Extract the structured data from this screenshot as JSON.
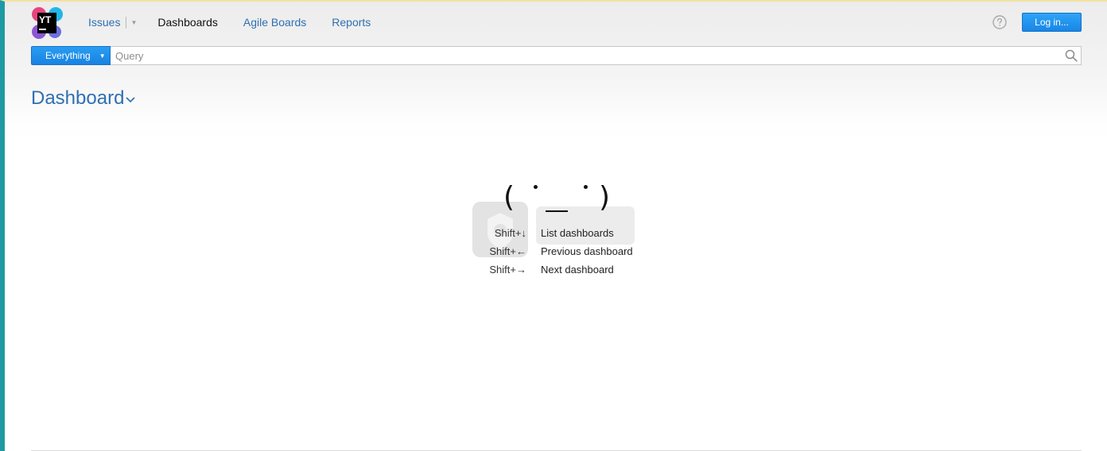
{
  "header": {
    "logo_text": "YT",
    "nav": [
      {
        "label": "Issues"
      },
      {
        "label": "Dashboards"
      },
      {
        "label": "Agile Boards"
      },
      {
        "label": "Reports"
      }
    ],
    "help_icon": "question-circle-icon",
    "login_label": "Log in..."
  },
  "search": {
    "context_label": "Everything",
    "placeholder": "Query",
    "value": ""
  },
  "main": {
    "title": "Dashboard",
    "empty_state": {
      "emoticon": "( ・_・ )",
      "shortcuts": [
        {
          "key": "Shift+↓",
          "desc": "List dashboards"
        },
        {
          "key": "Shift+←",
          "desc": "Previous dashboard"
        },
        {
          "key": "Shift+→",
          "desc": "Next dashboard"
        }
      ]
    }
  },
  "colors": {
    "accent": "#2f6fb3",
    "button": "#1a86e6",
    "left_border": "#1e9aa3"
  }
}
